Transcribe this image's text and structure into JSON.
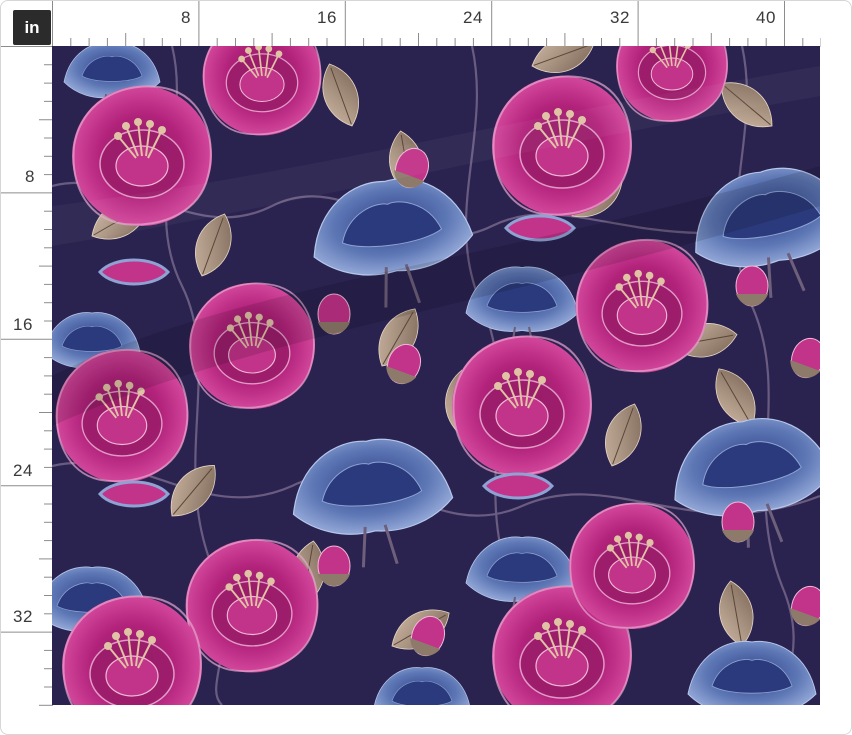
{
  "ruler": {
    "unit": "in",
    "top_labels": [
      "8",
      "16",
      "24",
      "32",
      "40"
    ],
    "left_labels": [
      "8",
      "16",
      "24",
      "32"
    ]
  },
  "fabric": {
    "background_color": "#2a2350",
    "motif_colors": {
      "magenta": "#b3237c",
      "magenta_light": "#d2479b",
      "blue": "#5d77b5",
      "navy": "#2f3f86",
      "leaf": "#a08873",
      "stamen": "#d9b99a"
    }
  }
}
